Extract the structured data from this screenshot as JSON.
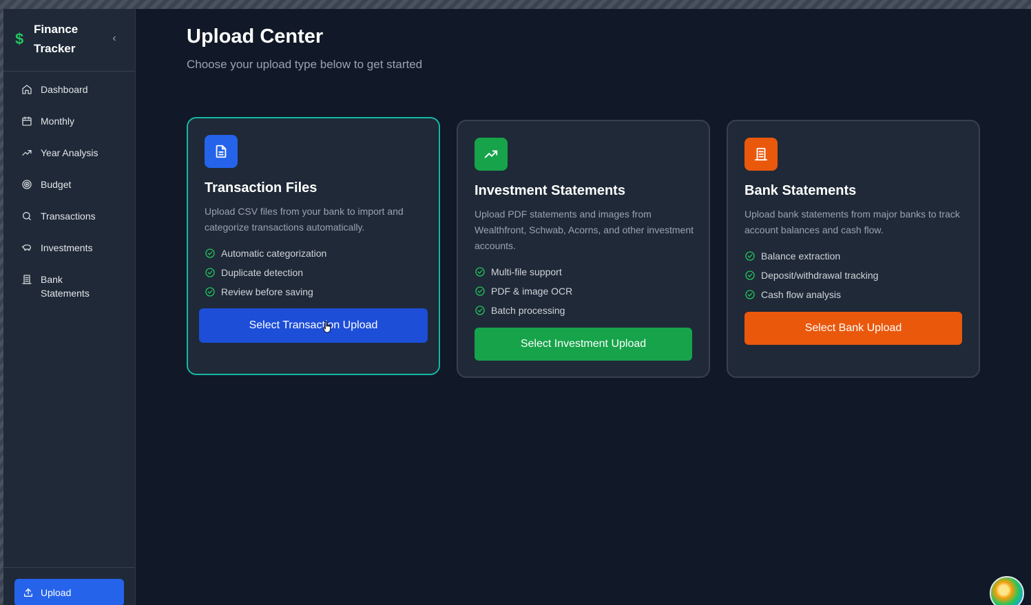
{
  "app": {
    "title": "Finance Tracker",
    "brand_icon": "dollar-icon",
    "collapse_icon": "chevron-left-icon"
  },
  "sidebar": {
    "items": [
      {
        "label": "Dashboard",
        "icon": "home-icon"
      },
      {
        "label": "Monthly",
        "icon": "calendar-icon"
      },
      {
        "label": "Year Analysis",
        "icon": "trending-up-icon"
      },
      {
        "label": "Budget",
        "icon": "target-icon"
      },
      {
        "label": "Transactions",
        "icon": "search-icon"
      },
      {
        "label": "Investments",
        "icon": "piggy-bank-icon"
      },
      {
        "label": "Bank Statements",
        "icon": "bank-statement-icon"
      }
    ],
    "upload_label": "Upload",
    "upload_icon": "upload-icon"
  },
  "main": {
    "title": "Upload Center",
    "subtitle": "Choose your upload type below to get started",
    "cards": [
      {
        "title": "Transaction Files",
        "description": "Upload CSV files from your bank to import and categorize transactions automatically.",
        "features": [
          "Automatic categorization",
          "Duplicate detection",
          "Review before saving"
        ],
        "button": "Select Transaction Upload",
        "icon": "file-text-icon",
        "accent": "#2563eb",
        "selected": true
      },
      {
        "title": "Investment Statements",
        "description": "Upload PDF statements and images from Wealthfront, Schwab, Acorns, and other investment accounts.",
        "features": [
          "Multi-file support",
          "PDF & image OCR",
          "Batch processing"
        ],
        "button": "Select Investment Upload",
        "icon": "trending-up-icon",
        "accent": "#16a34a",
        "selected": false
      },
      {
        "title": "Bank Statements",
        "description": "Upload bank statements from major banks to track account balances and cash flow.",
        "features": [
          "Balance extraction",
          "Deposit/withdrawal tracking",
          "Cash flow analysis"
        ],
        "button": "Select Bank Upload",
        "icon": "bank-statement-icon",
        "accent": "#ea580c",
        "selected": false
      }
    ]
  },
  "colors": {
    "background": "#111827",
    "sidebar": "#1f2937",
    "check": "#22c55e",
    "selected_border": "#14b8a6"
  }
}
